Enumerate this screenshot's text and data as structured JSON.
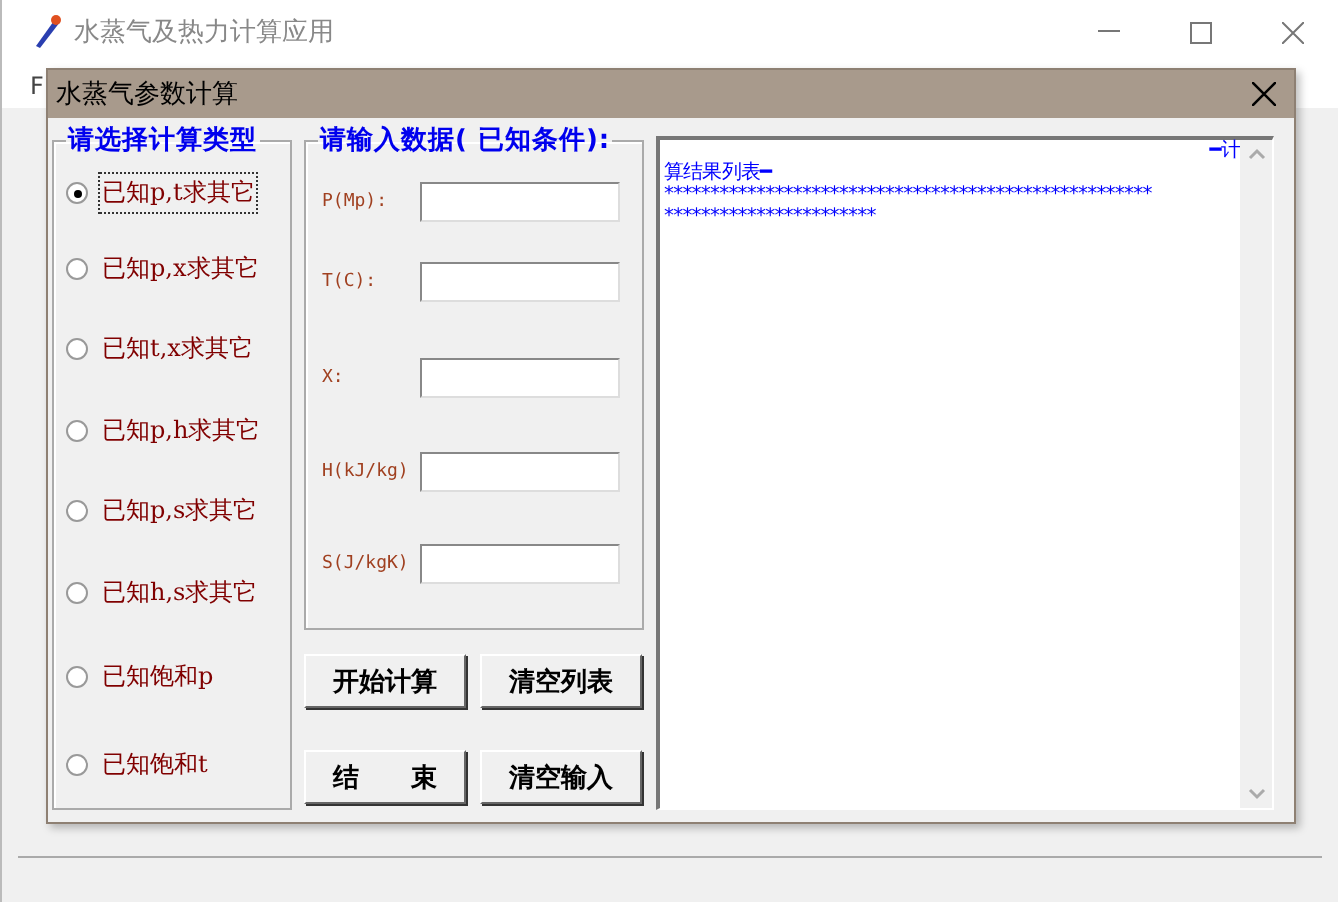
{
  "main_window": {
    "title": "水蒸气及热力计算应用",
    "menu": [
      "F"
    ]
  },
  "dialog": {
    "title": "水蒸气参数计算",
    "type_group": {
      "title": "请选择计算类型",
      "options": [
        {
          "label": "已知p,t求其它",
          "selected": true
        },
        {
          "label": "已知p,x求其它",
          "selected": false
        },
        {
          "label": "已知t,x求其它",
          "selected": false
        },
        {
          "label": "已知p,h求其它",
          "selected": false
        },
        {
          "label": "已知p,s求其它",
          "selected": false
        },
        {
          "label": "已知h,s求其它",
          "selected": false
        },
        {
          "label": "已知饱和p",
          "selected": false
        },
        {
          "label": "已知饱和t",
          "selected": false
        }
      ]
    },
    "input_group": {
      "title": "请输入数据( 已知条件):",
      "fields": [
        {
          "label": "P(Mp):"
        },
        {
          "label": "T(C):"
        },
        {
          "label": "X:"
        },
        {
          "label": "H(kJ/kg)"
        },
        {
          "label": "S(J/kgK)"
        }
      ]
    },
    "buttons": [
      "开始计算",
      "清空列表",
      "结　　束",
      "清空输入"
    ],
    "results": [
      {
        "kind": "right",
        "text": "━计"
      },
      {
        "kind": "left",
        "text": "算结果列表━"
      },
      {
        "kind": "left",
        "text": "*****************************************************"
      },
      {
        "kind": "left",
        "text": "***********************"
      }
    ]
  }
}
